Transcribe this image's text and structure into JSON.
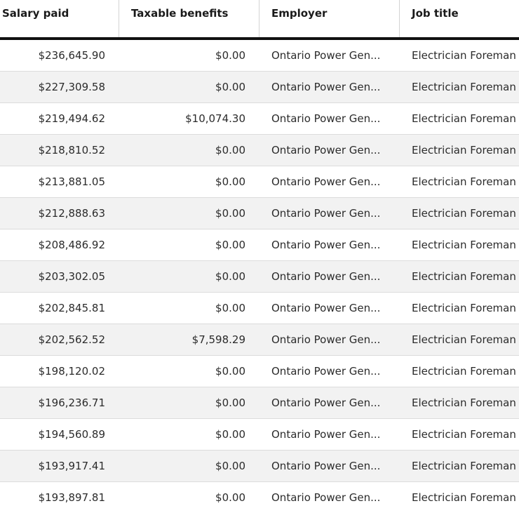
{
  "table": {
    "headers": {
      "salary": "Salary paid",
      "benefits": "Taxable benefits",
      "employer": "Employer",
      "job": "Job title"
    },
    "rows": [
      {
        "salary": "$236,645.90",
        "benefits": "$0.00",
        "employer": "Ontario Power Gen...",
        "job": "Electrician Foreman ..."
      },
      {
        "salary": "$227,309.58",
        "benefits": "$0.00",
        "employer": "Ontario Power Gen...",
        "job": "Electrician Foreman ..."
      },
      {
        "salary": "$219,494.62",
        "benefits": "$10,074.30",
        "employer": "Ontario Power Gen...",
        "job": "Electrician Foreman ..."
      },
      {
        "salary": "$218,810.52",
        "benefits": "$0.00",
        "employer": "Ontario Power Gen...",
        "job": "Electrician Foreman ..."
      },
      {
        "salary": "$213,881.05",
        "benefits": "$0.00",
        "employer": "Ontario Power Gen...",
        "job": "Electrician Foreman ..."
      },
      {
        "salary": "$212,888.63",
        "benefits": "$0.00",
        "employer": "Ontario Power Gen...",
        "job": "Electrician Foreman ..."
      },
      {
        "salary": "$208,486.92",
        "benefits": "$0.00",
        "employer": "Ontario Power Gen...",
        "job": "Electrician Foreman ..."
      },
      {
        "salary": "$203,302.05",
        "benefits": "$0.00",
        "employer": "Ontario Power Gen...",
        "job": "Electrician Foreman ..."
      },
      {
        "salary": "$202,845.81",
        "benefits": "$0.00",
        "employer": "Ontario Power Gen...",
        "job": "Electrician Foreman ..."
      },
      {
        "salary": "$202,562.52",
        "benefits": "$7,598.29",
        "employer": "Ontario Power Gen...",
        "job": "Electrician Foreman ..."
      },
      {
        "salary": "$198,120.02",
        "benefits": "$0.00",
        "employer": "Ontario Power Gen...",
        "job": "Electrician Foreman ..."
      },
      {
        "salary": "$196,236.71",
        "benefits": "$0.00",
        "employer": "Ontario Power Gen...",
        "job": "Electrician Foreman ..."
      },
      {
        "salary": "$194,560.89",
        "benefits": "$0.00",
        "employer": "Ontario Power Gen...",
        "job": "Electrician Foreman ..."
      },
      {
        "salary": "$193,917.41",
        "benefits": "$0.00",
        "employer": "Ontario Power Gen...",
        "job": "Electrician Foreman ..."
      },
      {
        "salary": "$193,897.81",
        "benefits": "$0.00",
        "employer": "Ontario Power Gen...",
        "job": "Electrician Foreman ..."
      }
    ]
  }
}
